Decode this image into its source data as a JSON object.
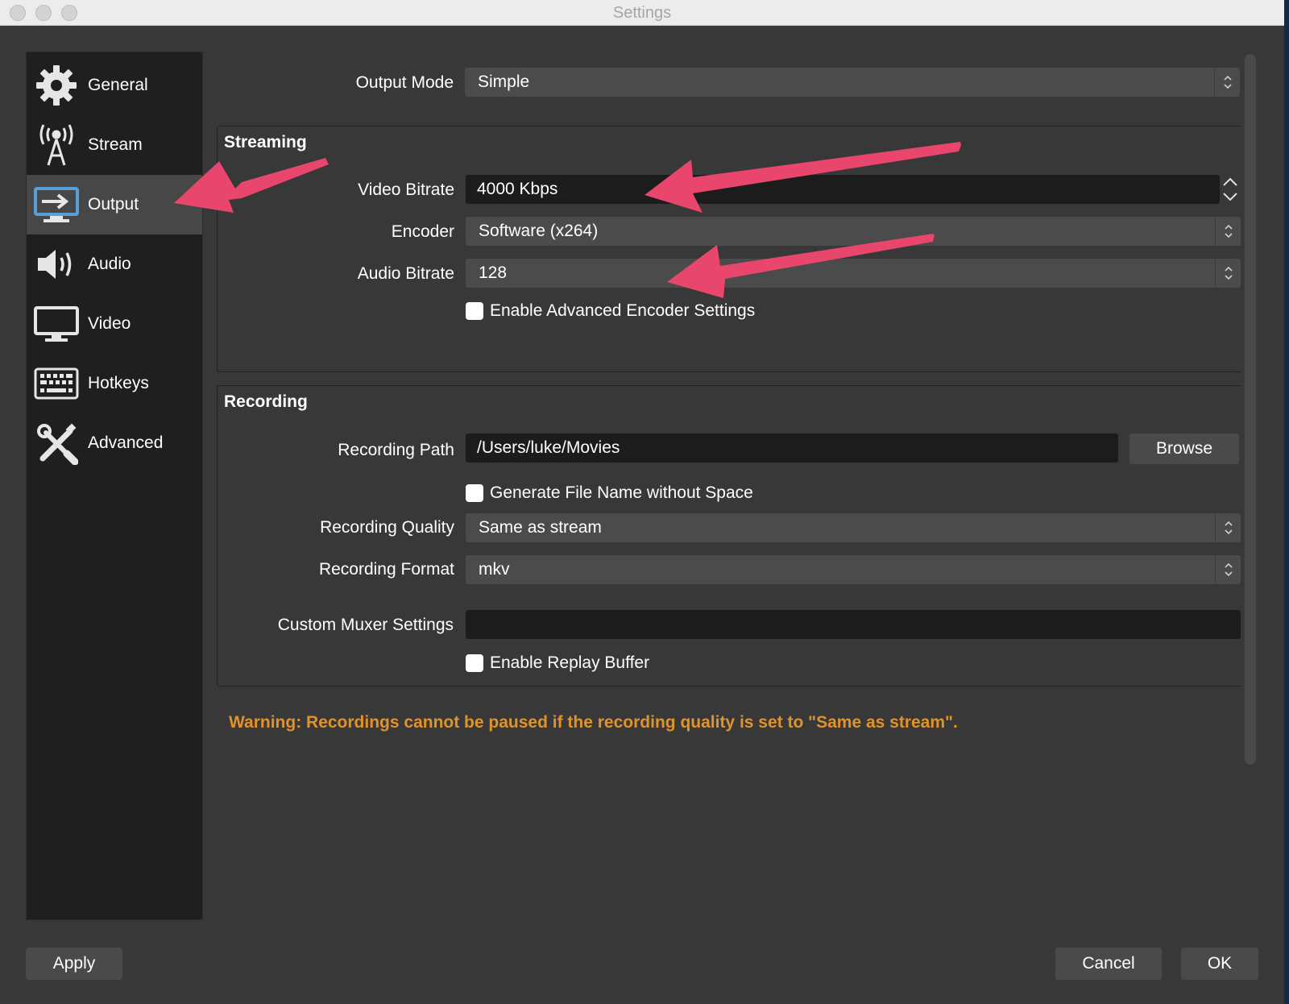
{
  "window": {
    "title": "Settings"
  },
  "sidebar": {
    "items": [
      {
        "label": "General",
        "icon": "gear-icon"
      },
      {
        "label": "Stream",
        "icon": "antenna-icon"
      },
      {
        "label": "Output",
        "icon": "monitor-arrow-icon",
        "active": true
      },
      {
        "label": "Audio",
        "icon": "speaker-icon"
      },
      {
        "label": "Video",
        "icon": "monitor-icon"
      },
      {
        "label": "Hotkeys",
        "icon": "keyboard-icon"
      },
      {
        "label": "Advanced",
        "icon": "tools-icon"
      }
    ]
  },
  "output_mode": {
    "label": "Output Mode",
    "value": "Simple"
  },
  "streaming": {
    "title": "Streaming",
    "video_bitrate": {
      "label": "Video Bitrate",
      "value": "4000 Kbps"
    },
    "encoder": {
      "label": "Encoder",
      "value": "Software (x264)"
    },
    "audio_bitrate": {
      "label": "Audio Bitrate",
      "value": "128"
    },
    "advanced_encoder": {
      "label": "Enable Advanced Encoder Settings",
      "checked": false
    }
  },
  "recording": {
    "title": "Recording",
    "path": {
      "label": "Recording Path",
      "value": "/Users/luke/Movies",
      "browse_label": "Browse"
    },
    "no_space": {
      "label": "Generate File Name without Space",
      "checked": false
    },
    "quality": {
      "label": "Recording Quality",
      "value": "Same as stream"
    },
    "format": {
      "label": "Recording Format",
      "value": "mkv"
    },
    "muxer": {
      "label": "Custom Muxer Settings",
      "value": ""
    },
    "replay_buffer": {
      "label": "Enable Replay Buffer",
      "checked": false
    }
  },
  "warning": "Warning: Recordings cannot be paused if the recording quality is set to \"Same as stream\".",
  "footer": {
    "apply_label": "Apply",
    "cancel_label": "Cancel",
    "ok_label": "OK"
  },
  "colors": {
    "accent_arrow": "#e8466d",
    "warning": "#e0932a",
    "active_item": "#474747"
  }
}
